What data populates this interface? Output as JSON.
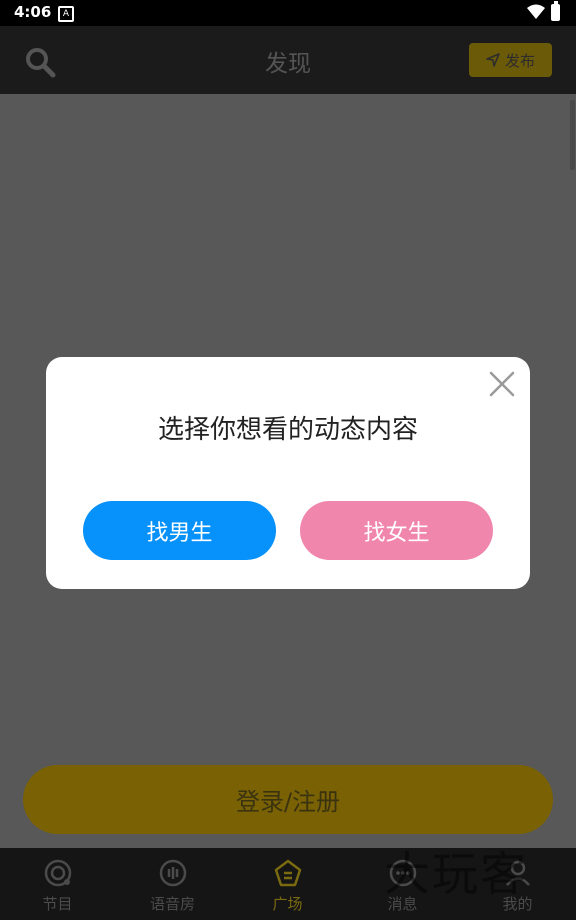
{
  "status_bar": {
    "time": "4:06",
    "notification_icon_letter": "A"
  },
  "header": {
    "title": "发现",
    "publish_label": "发布"
  },
  "main": {
    "login_label": "登录/注册"
  },
  "dialog": {
    "title": "选择你想看的动态内容",
    "male_button_label": "找男生",
    "female_button_label": "找女生",
    "male_color": "#0791fb",
    "female_color": "#f186ac"
  },
  "tabbar": {
    "items": [
      {
        "label": "节目",
        "icon": "broadcast-icon"
      },
      {
        "label": "语音房",
        "icon": "voice-room-icon"
      },
      {
        "label": "广场",
        "icon": "plaza-icon",
        "active": true
      },
      {
        "label": "消息",
        "icon": "message-icon"
      },
      {
        "label": "我的",
        "icon": "profile-icon"
      }
    ]
  },
  "watermark": "大玩客"
}
